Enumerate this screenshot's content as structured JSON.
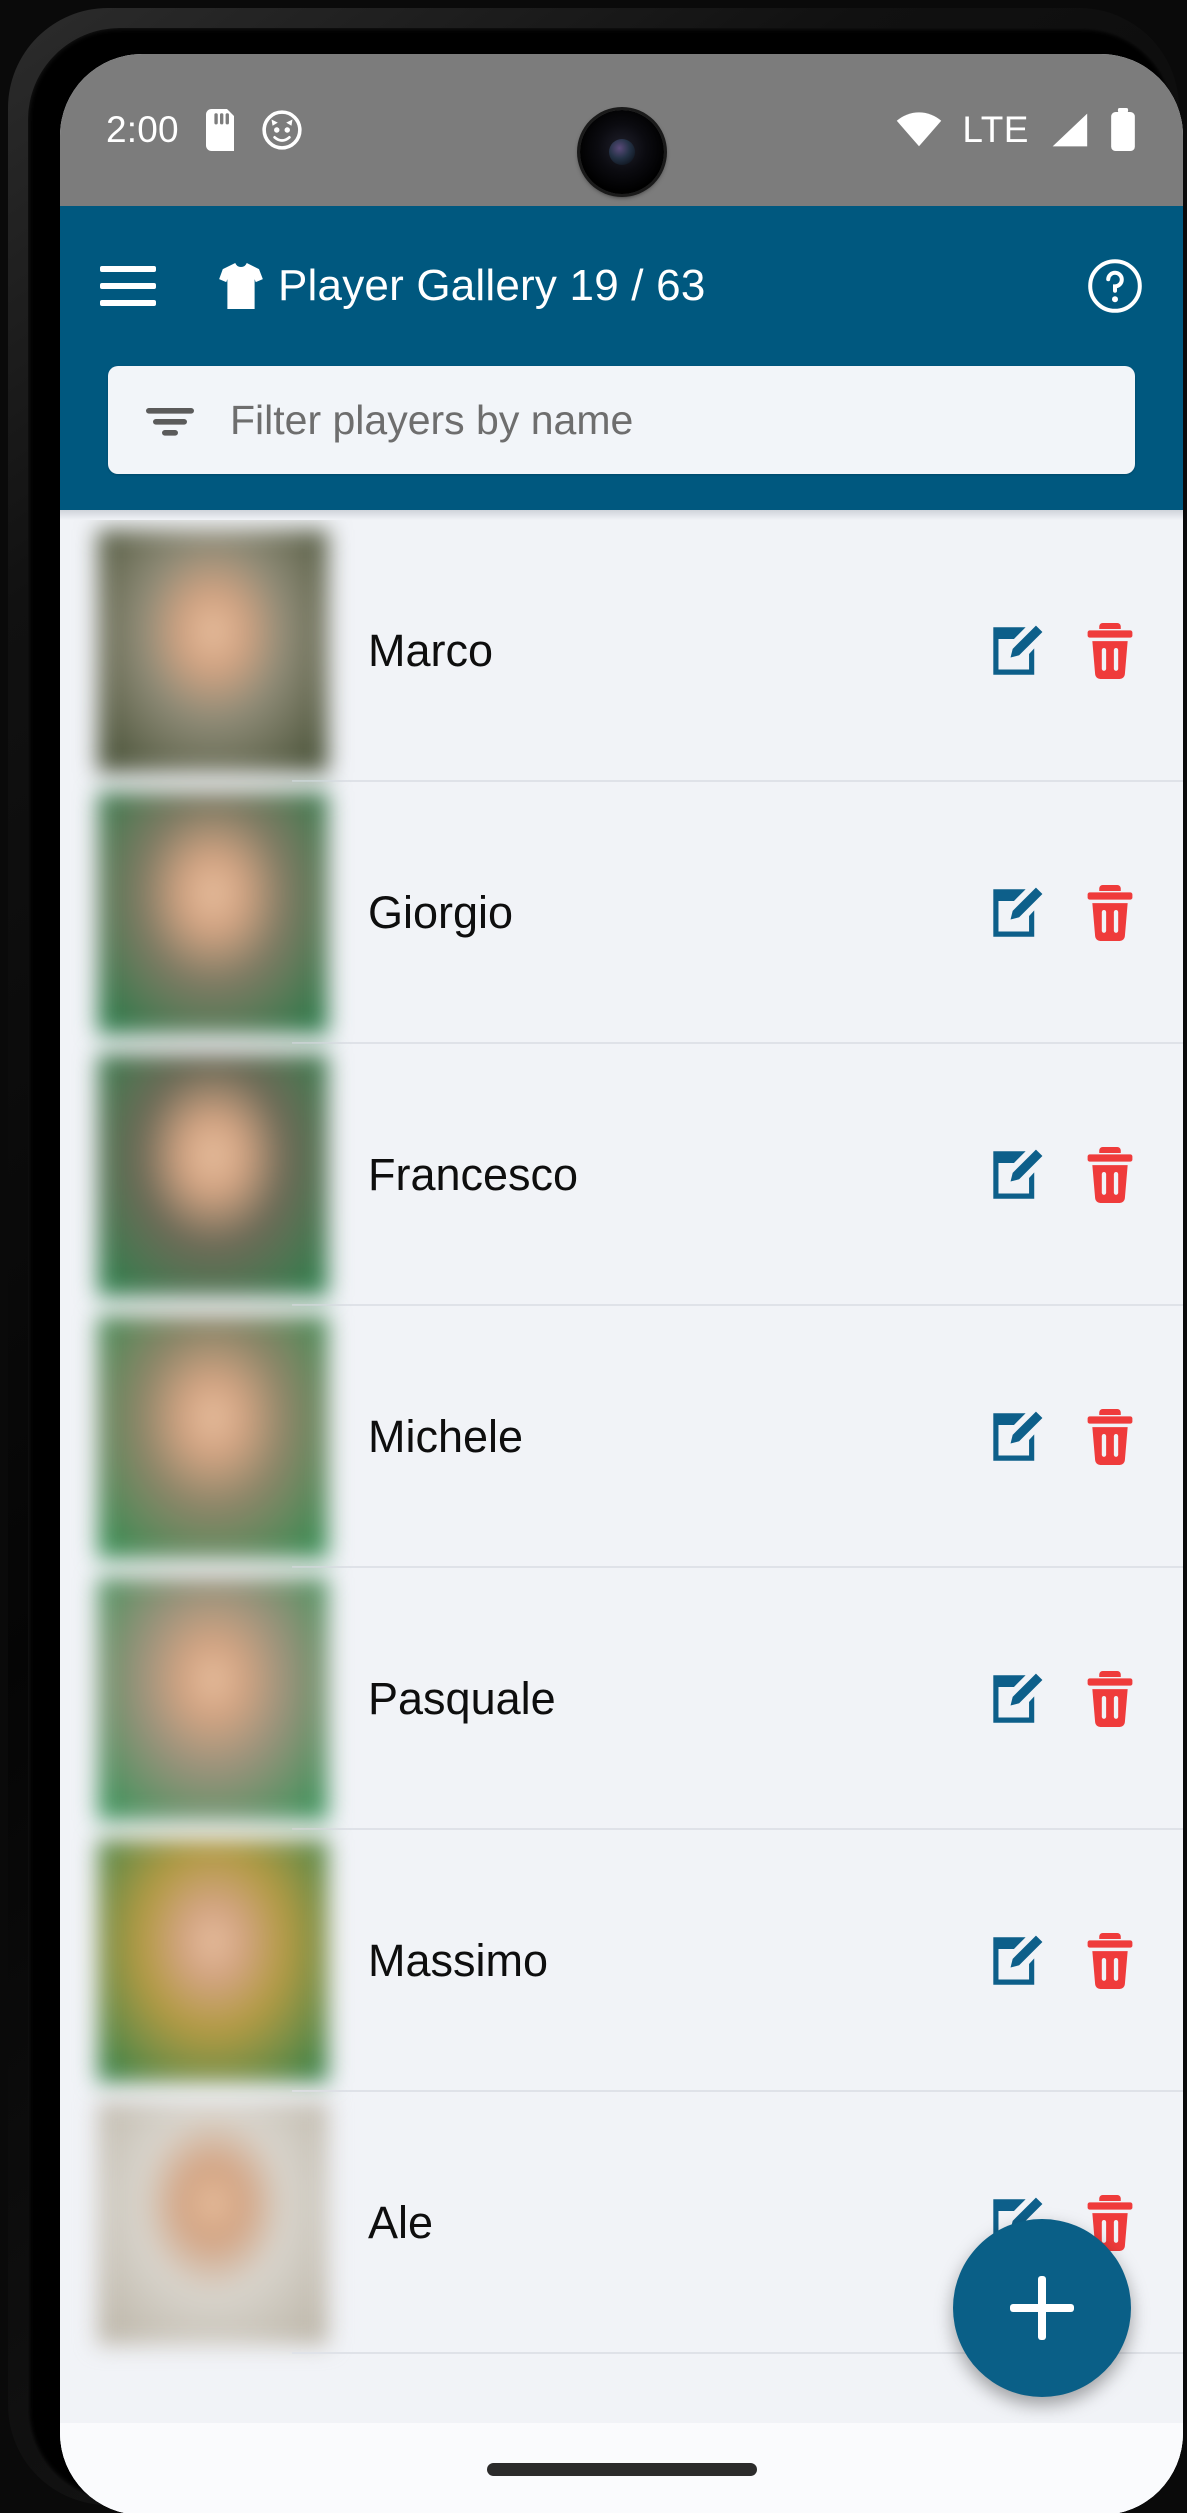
{
  "status_bar": {
    "time": "2:00",
    "network_label": "LTE",
    "icons": [
      "sd-card-icon",
      "cat-face-icon",
      "wifi-icon",
      "signal-icon",
      "battery-icon"
    ],
    "background_color": "#7c7c7c"
  },
  "app_bar": {
    "menu_icon": "hamburger-menu-icon",
    "brand_icon": "jersey-shirt-icon",
    "title": "Player Gallery 19 / 63",
    "help_icon": "help-circle-icon",
    "background_color": "#00587f",
    "text_color": "#ffffff"
  },
  "search": {
    "filter_icon": "filter-lines-icon",
    "placeholder": "Filter players by name",
    "value": "",
    "background_color": "#f2f5f9"
  },
  "players": [
    {
      "name": "Marco",
      "edit_label": "edit",
      "delete_label": "delete",
      "thumb_from": "#8d8a76",
      "thumb_to": "#3f4a2f"
    },
    {
      "name": "Giorgio",
      "edit_label": "edit",
      "delete_label": "delete",
      "thumb_from": "#7e7a63",
      "thumb_to": "#1f7a45"
    },
    {
      "name": "Francesco",
      "edit_label": "edit",
      "delete_label": "delete",
      "thumb_from": "#6d6a57",
      "thumb_to": "#27824b"
    },
    {
      "name": "Michele",
      "edit_label": "edit",
      "delete_label": "delete",
      "thumb_from": "#8c8568",
      "thumb_to": "#2b8d4f"
    },
    {
      "name": "Pasquale",
      "edit_label": "edit",
      "delete_label": "delete",
      "thumb_from": "#9a927b",
      "thumb_to": "#2f9356"
    },
    {
      "name": "Massimo",
      "edit_label": "edit",
      "delete_label": "delete",
      "thumb_from": "#b29a43",
      "thumb_to": "#2a7f4a"
    },
    {
      "name": "Ale",
      "edit_label": "edit",
      "delete_label": "delete",
      "thumb_from": "#d8d4cc",
      "thumb_to": "#b9b2a4"
    }
  ],
  "fab": {
    "label": "+",
    "name": "add-player-button",
    "color": "#0a5f87"
  },
  "nav_bar": {
    "gesture_pill": "home-gesture-pill"
  },
  "colors": {
    "accent": "#00587f",
    "edit_icon": "#0d5f8a",
    "delete_icon": "#ef3b3b",
    "page_background": "#f1f3f7"
  }
}
